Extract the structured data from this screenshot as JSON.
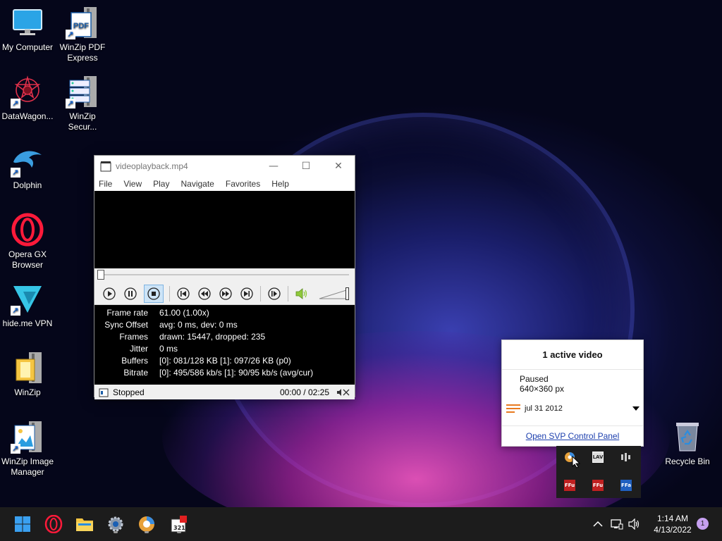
{
  "desktop": {
    "icons": [
      {
        "label": "My Computer"
      },
      {
        "label": "WinZip PDF Express"
      },
      {
        "label": "DataWagon..."
      },
      {
        "label": "WinZip Secur..."
      },
      {
        "label": "Dolphin"
      },
      {
        "label": "Opera GX Browser"
      },
      {
        "label": "hide.me VPN"
      },
      {
        "label": "WinZip"
      },
      {
        "label": "WinZip Image Manager"
      },
      {
        "label": "Recycle Bin"
      }
    ],
    "pdf_badge": "PDF"
  },
  "player": {
    "title": "videoplayback.mp4",
    "app_icon_text": "321",
    "menu": [
      "File",
      "View",
      "Play",
      "Navigate",
      "Favorites",
      "Help"
    ],
    "stats": [
      {
        "label": "Frame rate",
        "value": "61.00 (1.00x)"
      },
      {
        "label": "Sync Offset",
        "value": "avg: 0 ms, dev: 0 ms"
      },
      {
        "label": "Frames",
        "value": "drawn: 15447, dropped: 235"
      },
      {
        "label": "Jitter",
        "value": "0 ms"
      },
      {
        "label": "Buffers",
        "value": "[0]: 081/128 KB [1]: 097/26 KB (p0)"
      },
      {
        "label": "Bitrate",
        "value": "[0]: 495/586 kb/s [1]: 90/95 kb/s (avg/cur)"
      }
    ],
    "status": "Stopped",
    "time": "00:00 / 02:25",
    "volume_level": 1.0,
    "seek_position": 0
  },
  "svp_popup": {
    "header": "1 active video",
    "state": "Paused",
    "resolution": "640×360 px",
    "date": "jul 31 2012",
    "link": "Open SVP Control Panel"
  },
  "tray_overflow": {
    "lav_label": "LAV",
    "ffu_label": "FFu",
    "ffa_label": "FFa"
  },
  "taskbar": {
    "clock_time": "1:14 AM",
    "clock_date": "4/13/2022",
    "notification_count": "1",
    "mpc_icon_text": "321"
  },
  "colors": {
    "taskbar_bg": "#1c1c1c",
    "link": "#1c3fae",
    "accent": "#0078d4"
  }
}
